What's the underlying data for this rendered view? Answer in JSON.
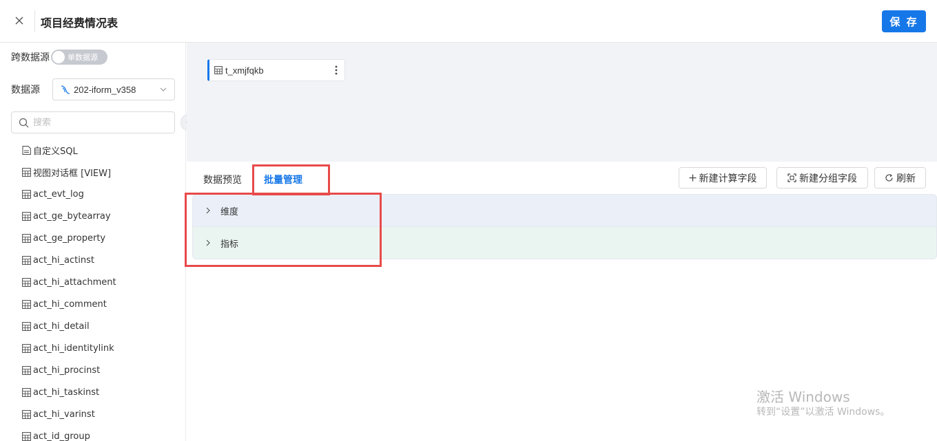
{
  "header": {
    "title": "项目经费情况表",
    "save_label": "保 存"
  },
  "sidebar": {
    "cross_source_label": "跨数据源",
    "toggle_text": "单数据源",
    "datasource_label": "数据源",
    "datasource_value": "202-iform_v358",
    "search_placeholder": "搜索",
    "tables": [
      {
        "label": "自定义SQL",
        "icon": "sql-icon"
      },
      {
        "label": "视图对话框 [VIEW]",
        "icon": "table-icon"
      },
      {
        "label": "act_evt_log",
        "icon": "table-icon"
      },
      {
        "label": "act_ge_bytearray",
        "icon": "table-icon"
      },
      {
        "label": "act_ge_property",
        "icon": "table-icon"
      },
      {
        "label": "act_hi_actinst",
        "icon": "table-icon"
      },
      {
        "label": "act_hi_attachment",
        "icon": "table-icon"
      },
      {
        "label": "act_hi_comment",
        "icon": "table-icon"
      },
      {
        "label": "act_hi_detail",
        "icon": "table-icon"
      },
      {
        "label": "act_hi_identitylink",
        "icon": "table-icon"
      },
      {
        "label": "act_hi_procinst",
        "icon": "table-icon"
      },
      {
        "label": "act_hi_taskinst",
        "icon": "table-icon"
      },
      {
        "label": "act_hi_varinst",
        "icon": "table-icon"
      },
      {
        "label": "act_id_group",
        "icon": "table-icon"
      }
    ]
  },
  "canvas": {
    "table_card_name": "t_xmjfqkb"
  },
  "bottom": {
    "tabs": [
      {
        "label": "数据预览",
        "active": false
      },
      {
        "label": "批量管理",
        "active": true
      }
    ],
    "buttons": {
      "new_calc_field": "新建计算字段",
      "new_group_field": "新建分组字段",
      "refresh": "刷新"
    },
    "sections": [
      {
        "label": "维度"
      },
      {
        "label": "指标"
      }
    ]
  },
  "watermark": {
    "title": "激活 Windows",
    "subtitle": "转到“设置”以激活 Windows。"
  },
  "colors": {
    "accent": "#1677e8",
    "highlight": "#e84a4a",
    "dimension_bg": "#ebf0f8",
    "metric_bg": "#eaf5f1"
  }
}
